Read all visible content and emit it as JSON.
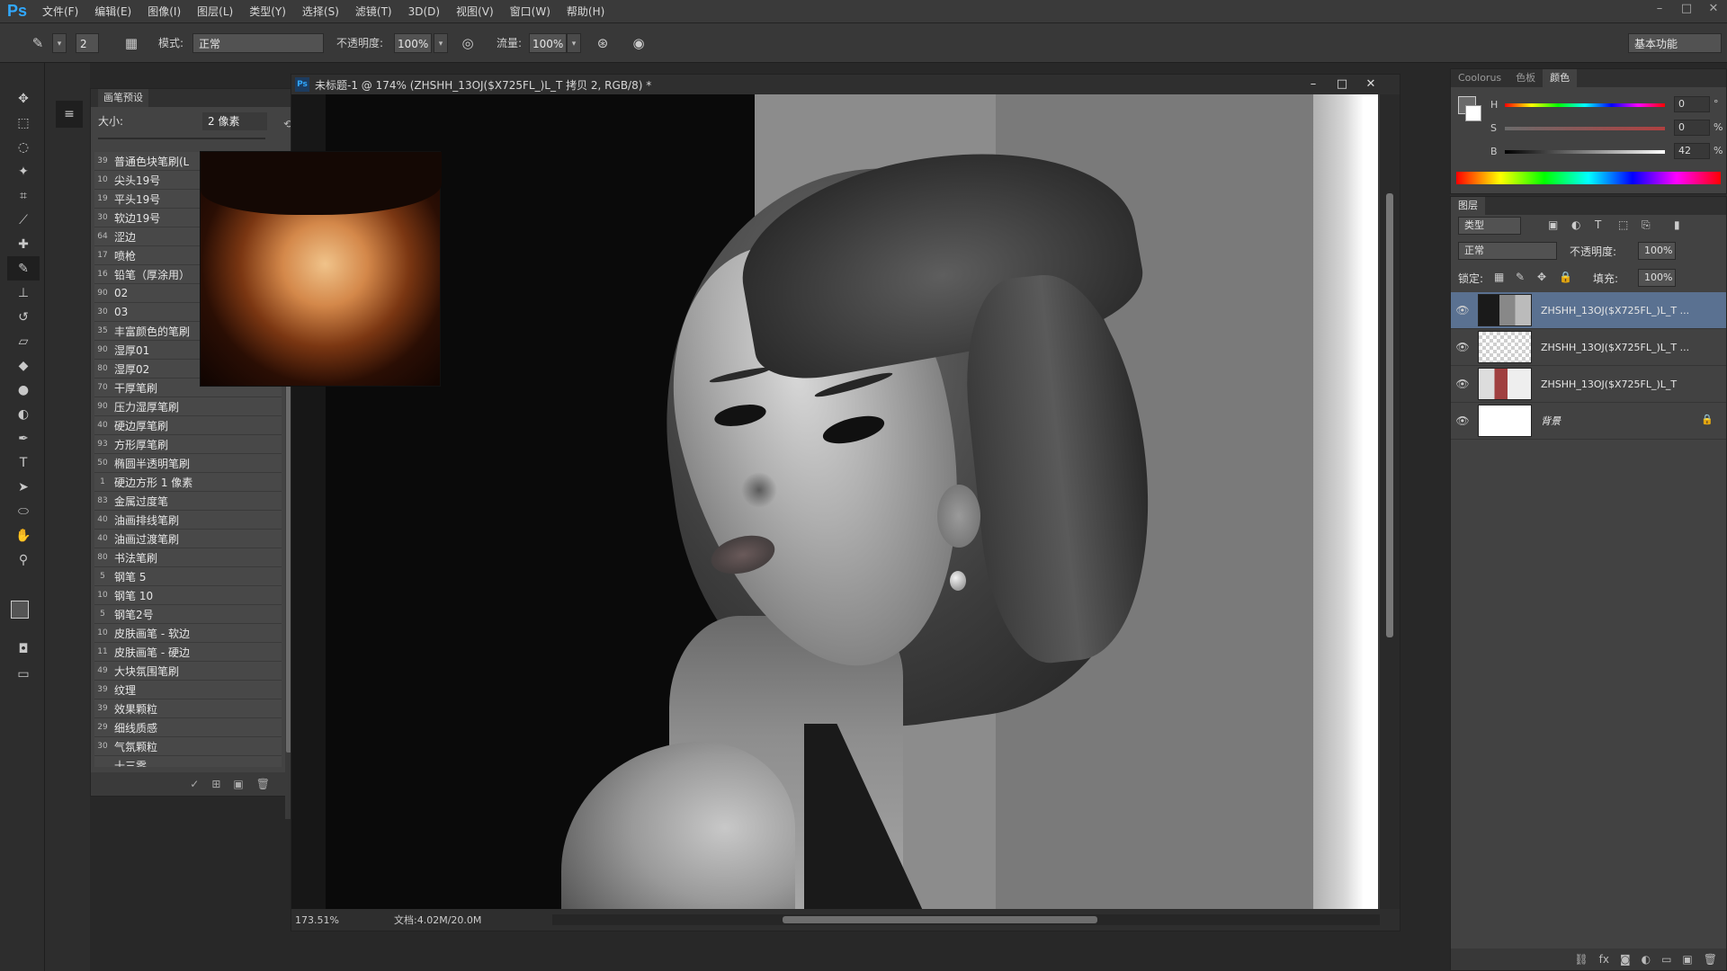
{
  "app": {
    "logo": "Ps"
  },
  "menu": [
    "文件(F)",
    "编辑(E)",
    "图像(I)",
    "图层(L)",
    "类型(Y)",
    "选择(S)",
    "滤镜(T)",
    "3D(D)",
    "视图(V)",
    "窗口(W)",
    "帮助(H)"
  ],
  "options": {
    "brush_size_small": "2",
    "mode_label": "模式:",
    "mode_value": "正常",
    "opacity_label": "不透明度:",
    "opacity_value": "100%",
    "flow_label": "流量:",
    "flow_value": "100%",
    "workspace": "基本功能"
  },
  "brush_panel": {
    "title": "画笔预设",
    "size_label": "大小:",
    "size_value": "2 像素",
    "brushes": [
      {
        "n": "39",
        "name": "普通色块笔刷(L"
      },
      {
        "n": "10",
        "name": "尖头19号"
      },
      {
        "n": "19",
        "name": "平头19号"
      },
      {
        "n": "30",
        "name": "软边19号"
      },
      {
        "n": "64",
        "name": "涩边"
      },
      {
        "n": "17",
        "name": "喷枪"
      },
      {
        "n": "16",
        "name": "铅笔（厚涂用）"
      },
      {
        "n": "90",
        "name": "02"
      },
      {
        "n": "30",
        "name": "03"
      },
      {
        "n": "35",
        "name": "丰富颜色的笔刷"
      },
      {
        "n": "90",
        "name": "湿厚01"
      },
      {
        "n": "80",
        "name": "湿厚02"
      },
      {
        "n": "70",
        "name": "干厚笔刷"
      },
      {
        "n": "90",
        "name": "压力湿厚笔刷"
      },
      {
        "n": "40",
        "name": "硬边厚笔刷"
      },
      {
        "n": "93",
        "name": "方形厚笔刷"
      },
      {
        "n": "50",
        "name": "椭圆半透明笔刷"
      },
      {
        "n": "1",
        "name": "硬边方形 1 像素"
      },
      {
        "n": "83",
        "name": "金属过度笔"
      },
      {
        "n": "40",
        "name": "油画排线笔刷"
      },
      {
        "n": "40",
        "name": "油画过渡笔刷"
      },
      {
        "n": "80",
        "name": "书法笔刷"
      },
      {
        "n": "5",
        "name": "钢笔 5"
      },
      {
        "n": "10",
        "name": "钢笔 10"
      },
      {
        "n": "5",
        "name": "钢笔2号"
      },
      {
        "n": "10",
        "name": "皮肤画笔 - 软边"
      },
      {
        "n": "11",
        "name": "皮肤画笔 - 硬边"
      },
      {
        "n": "49",
        "name": "大块氛围笔刷"
      },
      {
        "n": "39",
        "name": "纹理"
      },
      {
        "n": "39",
        "name": "效果颗粒"
      },
      {
        "n": "29",
        "name": "细线质感"
      },
      {
        "n": "30",
        "name": "气氛颗粒"
      },
      {
        "n": "",
        "name": "十三零"
      }
    ]
  },
  "document": {
    "title": "未标题-1 @ 174% (ZHSHH_13OJ($X725FL_)L_T 拷贝 2, RGB/8) *",
    "zoom": "173.51%",
    "doc_size": "文档:4.02M/20.0M"
  },
  "color_panel": {
    "tabs": [
      "Coolorus",
      "色板",
      "颜色"
    ],
    "active_tab": 2,
    "h": "0",
    "s": "0",
    "b": "42",
    "unit_h": "°",
    "unit_pct": "%"
  },
  "layers_panel": {
    "tab": "图层",
    "filter": "类型",
    "blend_mode": "正常",
    "opacity_label": "不透明度:",
    "opacity": "100%",
    "lock_label": "锁定:",
    "fill_label": "填充:",
    "fill": "100%",
    "layers": [
      {
        "name": "ZHSHH_13OJ($X725FL_)L_T ...",
        "selected": true
      },
      {
        "name": "ZHSHH_13OJ($X725FL_)L_T ...",
        "selected": false
      },
      {
        "name": "ZHSHH_13OJ($X725FL_)L_T",
        "selected": false
      },
      {
        "name": "背景",
        "selected": false,
        "locked": true
      }
    ]
  },
  "colors": {
    "accent": "#31a8ff",
    "selected_layer": "#5a7191"
  }
}
